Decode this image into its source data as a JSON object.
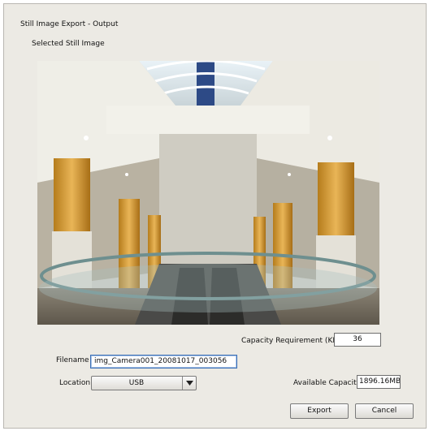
{
  "dialog": {
    "title": "Still Image Export - Output",
    "subtitle": "Selected Still Image"
  },
  "capacity_requirement": {
    "label": "Capacity Requirement (KB):",
    "value": "36"
  },
  "filename": {
    "label": "Filename",
    "value": "img_Camera001_20081017_003056"
  },
  "location": {
    "label": "Location",
    "selected": "USB",
    "arrow_icon": "chevron-down-icon"
  },
  "available_capacity": {
    "label": "Available Capacity(",
    "value": "1896.16MB"
  },
  "buttons": {
    "export": "Export",
    "cancel": "Cancel"
  }
}
